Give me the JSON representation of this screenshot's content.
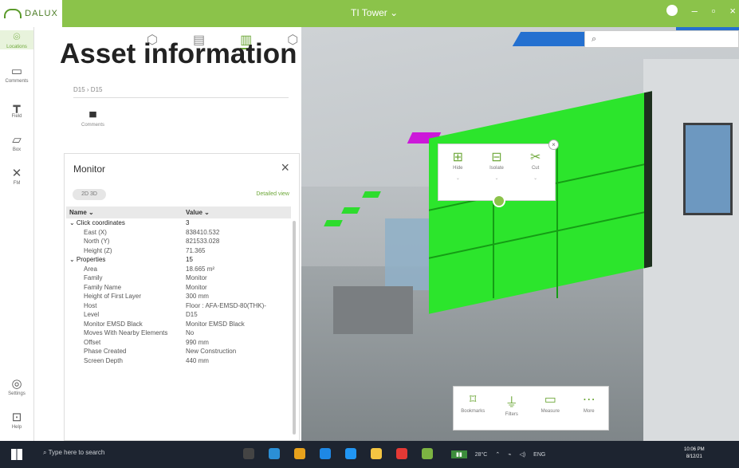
{
  "brand": {
    "name": "DALUX"
  },
  "window": {
    "title": "TI Tower ⌄"
  },
  "heading": "Asset information",
  "rail": [
    {
      "label": "Locations",
      "icon": "location-pin-icon"
    },
    {
      "label": "Comments",
      "icon": "comments-icon"
    },
    {
      "label": "Field",
      "icon": "crane-icon"
    },
    {
      "label": "Box",
      "icon": "folder-icon"
    },
    {
      "label": "FM",
      "icon": "tools-icon"
    },
    {
      "label": "Settings",
      "icon": "settings-icon"
    },
    {
      "label": "Help",
      "icon": "help-icon"
    }
  ],
  "locations": {
    "path": "D15 › D15",
    "comments_label": "Comments"
  },
  "search": {
    "placeholder": ""
  },
  "context_menu": [
    {
      "label": "Hide",
      "icon": "hide-icon"
    },
    {
      "label": "Isolate",
      "icon": "isolate-icon"
    },
    {
      "label": "Cut",
      "icon": "scissors-icon"
    }
  ],
  "bottom_tools": [
    {
      "label": "Bookmarks",
      "icon": "bookmark-icon"
    },
    {
      "label": "Filters",
      "icon": "filter-icon"
    },
    {
      "label": "Measure",
      "icon": "ruler-icon"
    },
    {
      "label": "More",
      "icon": "more-icon"
    }
  ],
  "monitor_panel": {
    "title": "Monitor",
    "pill": "2D 3D",
    "link": "Detailed view",
    "col_name": "Name ⌄",
    "col_value": "Value ⌄",
    "rows": [
      {
        "name": "⌄ Click coordinates",
        "value": "3",
        "group": true
      },
      {
        "name": "East (X)",
        "value": "838410.532"
      },
      {
        "name": "North (Y)",
        "value": "821533.028"
      },
      {
        "name": "Height (Z)",
        "value": "71.365"
      },
      {
        "name": "⌄ Properties",
        "value": "15",
        "group": true
      },
      {
        "name": "Area",
        "value": "18.665 m²"
      },
      {
        "name": "Family",
        "value": "Monitor"
      },
      {
        "name": "Family Name",
        "value": "Monitor"
      },
      {
        "name": "Height of First Layer",
        "value": "300 mm"
      },
      {
        "name": "Host",
        "value": "Floor : AFA-EMSD-80(THK)-"
      },
      {
        "name": "Level",
        "value": "D15"
      },
      {
        "name": "Monitor EMSD Black",
        "value": "Monitor EMSD Black"
      },
      {
        "name": "Moves With Nearby Elements",
        "value": "No"
      },
      {
        "name": "Offset",
        "value": "990 mm"
      },
      {
        "name": "Phase Created",
        "value": "New Construction"
      },
      {
        "name": "Screen Depth",
        "value": "440 mm"
      }
    ]
  },
  "taskbar": {
    "search_placeholder": "Type here to search",
    "weather": "28°C",
    "lang": "ENG",
    "time": "10:06 PM",
    "date": "8/12/21"
  },
  "colors": {
    "accent": "#8bc34a",
    "model_green": "#2ce52c",
    "magenta": "#cc19d9",
    "blue": "#2470d0"
  }
}
